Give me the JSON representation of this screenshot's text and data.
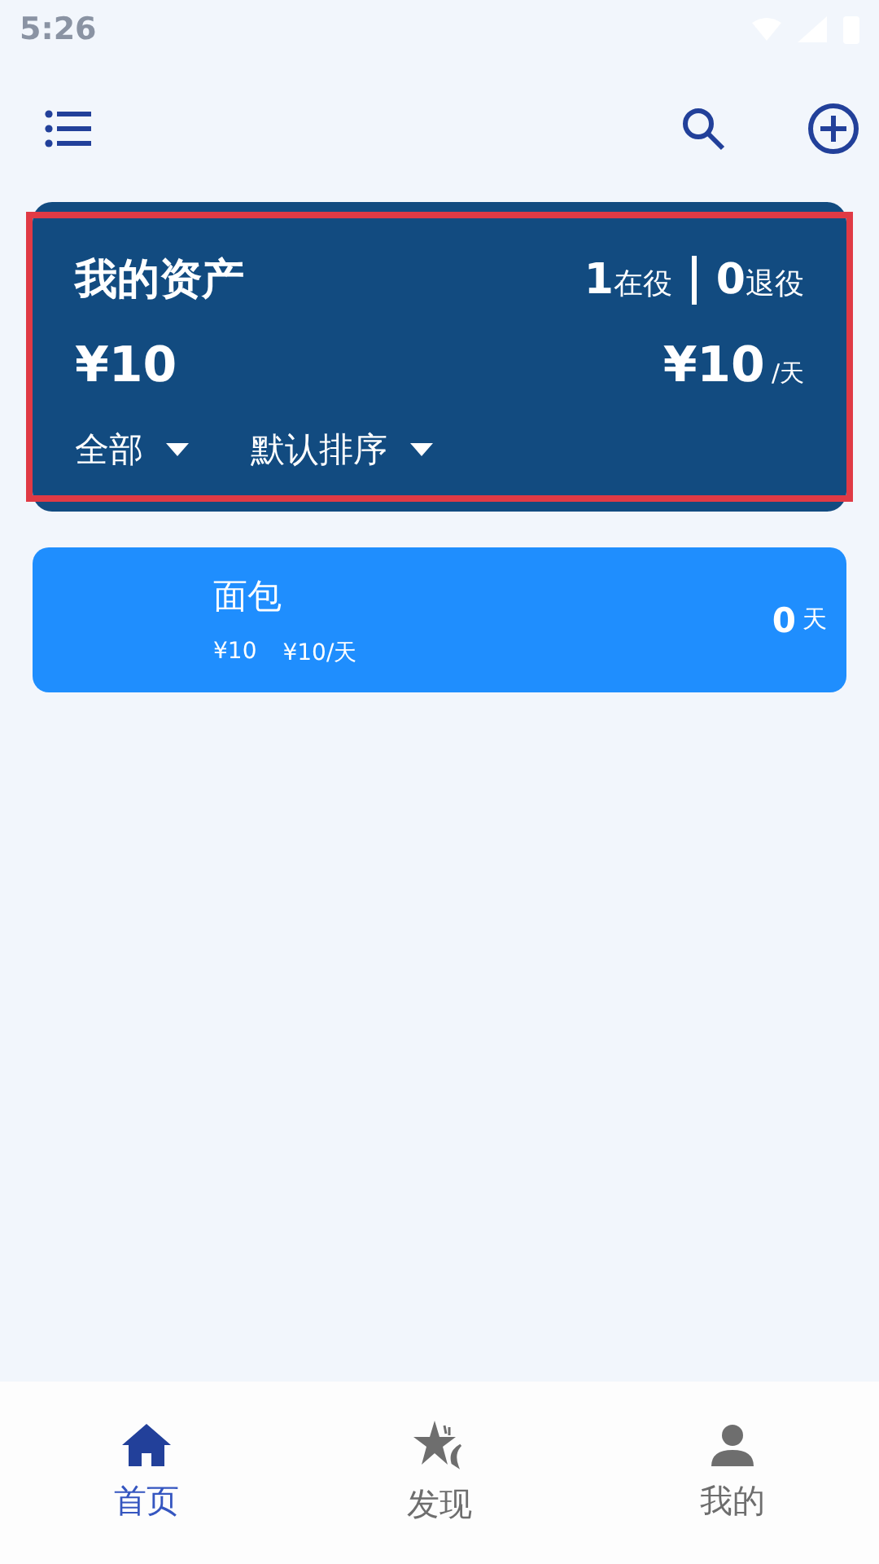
{
  "status_bar": {
    "time": "5:26"
  },
  "summary": {
    "title": "我的资产",
    "active_count": "1",
    "active_label": "在役",
    "retired_count": "0",
    "retired_label": "退役",
    "total": "¥10",
    "daily": "¥10",
    "daily_unit": "/天",
    "highlighted": true,
    "filters": [
      {
        "label": "全部"
      },
      {
        "label": "默认排序"
      }
    ]
  },
  "items": [
    {
      "name": "面包",
      "price": "¥10",
      "daily": "¥10/天",
      "days": "0",
      "days_unit": "天"
    }
  ],
  "nav": [
    {
      "label": "首页",
      "kind": "home",
      "selected": true
    },
    {
      "label": "发现",
      "kind": "star",
      "selected": false
    },
    {
      "label": "我的",
      "kind": "person",
      "selected": false
    }
  ]
}
